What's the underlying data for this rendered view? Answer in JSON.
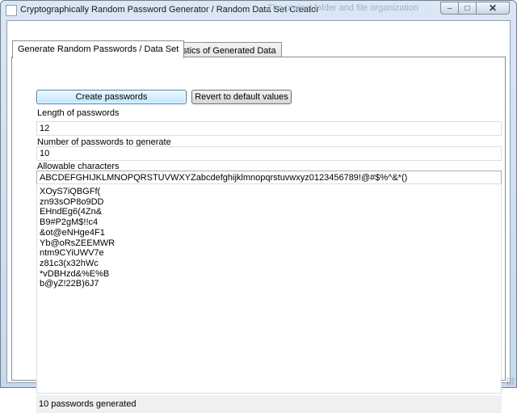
{
  "window": {
    "title": "Cryptographically Random Password Generator / Random Data Set Creator",
    "background_text": "The project folder and file organization",
    "controls": {
      "minimize": "–",
      "maximize": "□",
      "close": "✕"
    }
  },
  "tabs": [
    {
      "label": "Generate Random Passwords / Data Set",
      "active": true
    },
    {
      "label": "Statistics of Generated Data",
      "active": false
    }
  ],
  "buttons": {
    "create": "Create passwords",
    "revert": "Revert to default values"
  },
  "fields": {
    "length_label": "Length of passwords",
    "length_value": "12",
    "count_label": "Number of passwords to generate",
    "count_value": "10",
    "chars_label": "Allowable characters",
    "chars_value": "ABCDEFGHIJKLMNOPQRSTUVWXYZabcdefghijklmnopqrstuvwxyz0123456789!@#$%^&*()"
  },
  "passwords": [
    "XOyS7iQBGFf(",
    "zn93sOP8o9DD",
    "EHndEg6(4Zn&",
    "B9#P2gM$!!c4",
    "&ot@eNHge4F1",
    "Yb@oRsZEEMWR",
    "ntm9CYiUWV7e",
    "z81c3(x32hWc",
    "*vDBHzd&%E%B",
    "b@yZ!22B)6J7"
  ],
  "status": "10 passwords generated"
}
